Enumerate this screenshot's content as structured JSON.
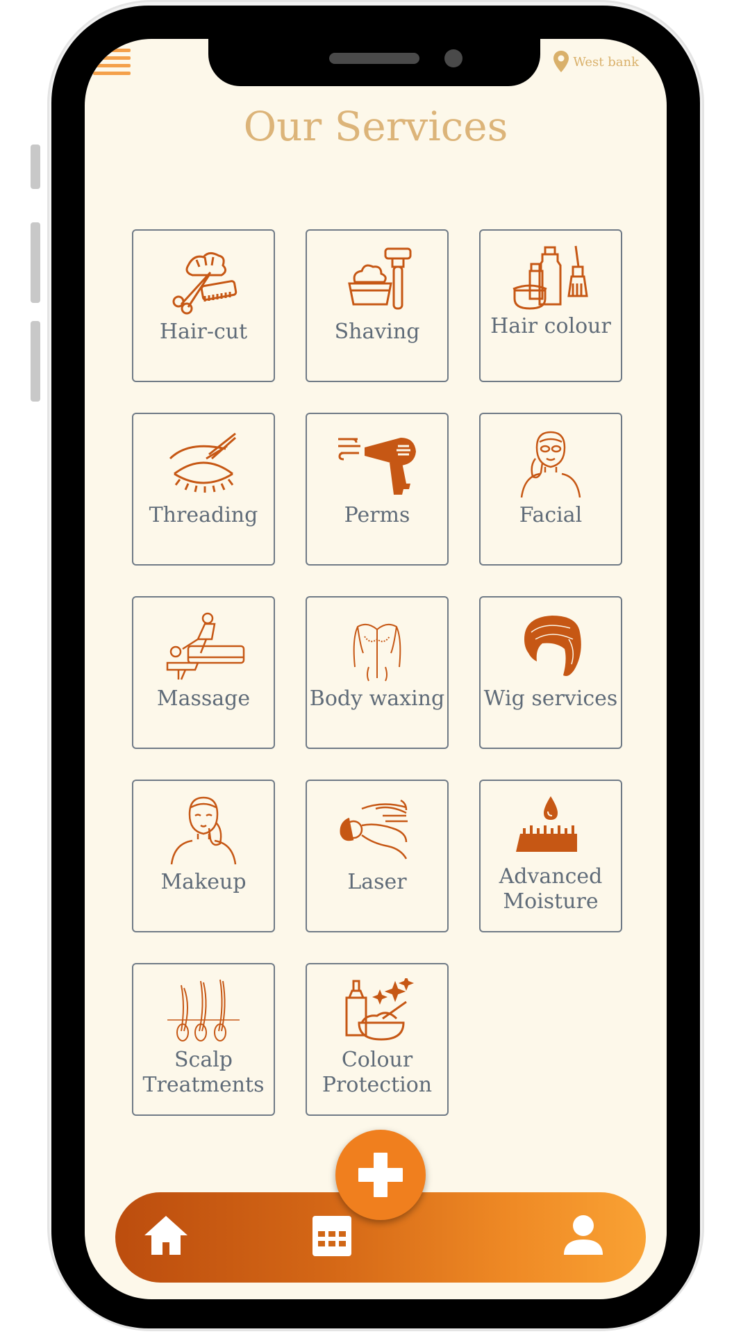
{
  "header": {
    "location_label": "West bank",
    "title": "Our Services"
  },
  "services": [
    {
      "label": "Hair-cut",
      "icon": "haircut-icon"
    },
    {
      "label": "Shaving",
      "icon": "shaving-icon"
    },
    {
      "label": "Hair colour",
      "icon": "hair-colour-icon"
    },
    {
      "label": "Threading",
      "icon": "threading-icon"
    },
    {
      "label": "Perms",
      "icon": "hair-dryer-icon"
    },
    {
      "label": "Facial",
      "icon": "facial-icon"
    },
    {
      "label": "Massage",
      "icon": "massage-icon"
    },
    {
      "label": "Body waxing",
      "icon": "body-waxing-icon"
    },
    {
      "label": "Wig services",
      "icon": "wig-icon"
    },
    {
      "label": "Makeup",
      "icon": "makeup-icon"
    },
    {
      "label": "Laser",
      "icon": "laser-icon"
    },
    {
      "label": "Advanced Moisture",
      "icon": "moisture-icon"
    },
    {
      "label": "Scalp Treatments",
      "icon": "scalp-icon"
    },
    {
      "label": "Colour Protection",
      "icon": "colour-protection-icon"
    }
  ],
  "nav": {
    "items": [
      "home-icon",
      "calendar-icon",
      "profile-icon"
    ],
    "fab_icon": "plus-icon"
  },
  "colors": {
    "accent": "#f07f1e",
    "icon": "#c65714",
    "title": "#dcb479",
    "background": "#fdf8ea"
  }
}
